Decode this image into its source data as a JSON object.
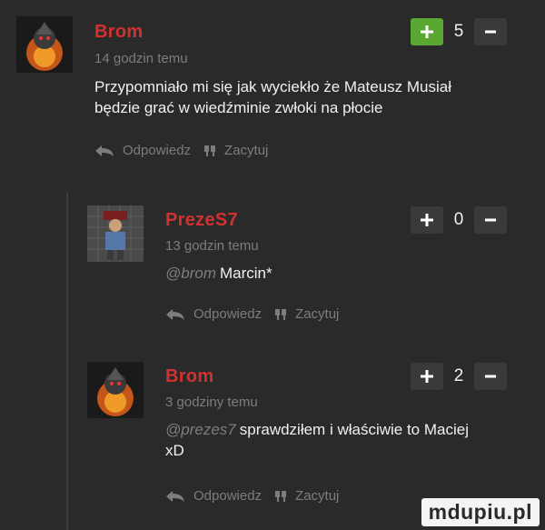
{
  "comments": [
    {
      "author": "Brom",
      "time": "14 godzin temu",
      "text_line1": "Przypomniało mi się jak wyciekło że Mateusz Musiał",
      "text_line2": "będzie grać w wiedźminie zwłoki na płocie",
      "votes": "5",
      "reply_label": "Odpowiedz",
      "quote_label": "Zacytuj"
    },
    {
      "author": "PrezeS7",
      "time": "13 godzin temu",
      "mention": "@brom",
      "text": "Marcin*",
      "votes": "0",
      "reply_label": "Odpowiedz",
      "quote_label": "Zacytuj"
    },
    {
      "author": "Brom",
      "time": "3 godziny temu",
      "mention": "@prezes7",
      "text_line1": "sprawdziłem i właściwie to Maciej",
      "text_line2": "xD",
      "votes": "2",
      "reply_label": "Odpowiedz",
      "quote_label": "Zacytuj"
    }
  ],
  "watermark": "mdupiu.pl",
  "colors": {
    "author": "#d23131",
    "plus_active": "#5aa832",
    "background": "#2a2a2a"
  },
  "icons": [
    "reply-arrow-icon",
    "quote-icon",
    "plus-icon",
    "minus-icon"
  ]
}
